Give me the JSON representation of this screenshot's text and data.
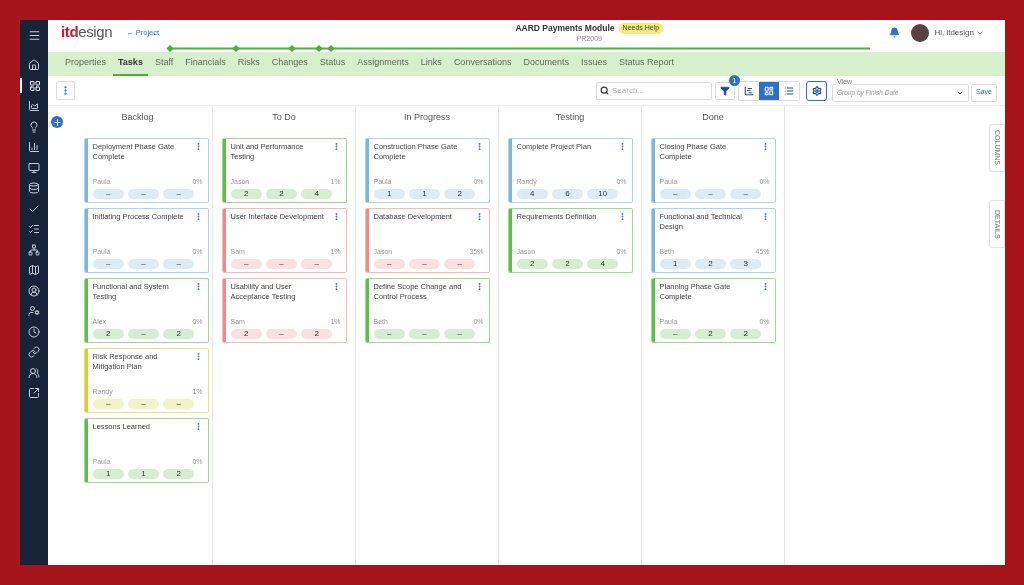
{
  "sidebar": {
    "items": [
      {
        "selected": false
      },
      {
        "selected": true
      },
      {
        "selected": false
      },
      {
        "selected": false
      },
      {
        "selected": false
      },
      {
        "selected": false
      },
      {
        "selected": false
      },
      {
        "selected": false
      },
      {
        "selected": false
      },
      {
        "selected": false
      },
      {
        "selected": false
      },
      {
        "selected": false
      },
      {
        "selected": false
      },
      {
        "selected": false
      },
      {
        "selected": false
      },
      {
        "selected": false
      },
      {
        "selected": false
      }
    ]
  },
  "header": {
    "logo_accent": "itd",
    "logo_rest": "esign",
    "back_link": "← Project",
    "title": "AARD Payments Module",
    "badge": "Needs Help",
    "code": "PR2009",
    "user": "Hi, itdesign"
  },
  "tabs": [
    {
      "label": "Properties",
      "selected": false
    },
    {
      "label": "Tasks",
      "selected": true
    },
    {
      "label": "Staff",
      "selected": false
    },
    {
      "label": "Financials",
      "selected": false
    },
    {
      "label": "Risks",
      "selected": false
    },
    {
      "label": "Changes",
      "selected": false
    },
    {
      "label": "Status",
      "selected": false
    },
    {
      "label": "Assignments",
      "selected": false
    },
    {
      "label": "Links",
      "selected": false
    },
    {
      "label": "Conversations",
      "selected": false
    },
    {
      "label": "Documents",
      "selected": false
    },
    {
      "label": "Issues",
      "selected": false
    },
    {
      "label": "Status Report",
      "selected": false
    }
  ],
  "toolbar": {
    "search": {
      "placeholder": "Search..."
    },
    "filter_count": "1",
    "view_modes": [
      {
        "kind": "gantt",
        "selected": false
      },
      {
        "kind": "board",
        "selected": true
      },
      {
        "kind": "list",
        "selected": false
      }
    ],
    "view": {
      "label": "View",
      "value": "Group by Finish Date"
    },
    "save": "Save"
  },
  "side_tabs": [
    "COLUMNS",
    "DETAILS"
  ],
  "columns": [
    {
      "title": "Backlog",
      "cards": [
        {
          "title": "Deployment Phase Gate Complete",
          "assignee": "Paula",
          "percent": "0%",
          "color": "#7ab6dd",
          "pills": [
            "–",
            "–",
            "–"
          ]
        },
        {
          "title": "Initiating Process Complete",
          "assignee": "Paula",
          "percent": "0%",
          "color": "#7ab6dd",
          "pills": [
            "–",
            "–",
            "–"
          ]
        },
        {
          "title": "Functional and System Testing",
          "assignee": "Alex",
          "percent": "0%",
          "color": "#5cbf4a",
          "pills": [
            "2",
            "–",
            "2"
          ]
        },
        {
          "title": "Risk Response and Mitigation Plan",
          "assignee": "Randy",
          "percent": "1%",
          "color": "#d6cf2e",
          "pills": [
            "–",
            "–",
            "–"
          ]
        },
        {
          "title": "Lessons Learned",
          "assignee": "Paula",
          "percent": "0%",
          "color": "#5cbf4a",
          "pills": [
            "1",
            "1",
            "2"
          ]
        }
      ]
    },
    {
      "title": "To Do",
      "cards": [
        {
          "title": "Unit and Performance Testing",
          "assignee": "Jason",
          "percent": "1%",
          "color": "#5cbf4a",
          "pills": [
            "2",
            "2",
            "4"
          ]
        },
        {
          "title": "User Interface Development",
          "assignee": "Sam",
          "percent": "1%",
          "color": "#ee8a8a",
          "pills": [
            "–",
            "–",
            "–"
          ]
        },
        {
          "title": "Usability and User Acceptance Testing",
          "assignee": "Sam",
          "percent": "1%",
          "color": "#ee8a8a",
          "pills": [
            "2",
            "–",
            "2"
          ]
        }
      ]
    },
    {
      "title": "In Progress",
      "cards": [
        {
          "title": "Construction Phase Gate Complete",
          "assignee": "Paula",
          "percent": "0%",
          "color": "#7ab6dd",
          "pills": [
            "1",
            "1",
            "2"
          ]
        },
        {
          "title": "Database Development",
          "assignee": "Jason",
          "percent": "35%",
          "color": "#ee8a8a",
          "pills": [
            "–",
            "–",
            "–"
          ]
        },
        {
          "title": "Define Scope Change and Control Process",
          "assignee": "Beth",
          "percent": "0%",
          "color": "#5cbf4a",
          "pills": [
            "–",
            "–",
            "–"
          ]
        }
      ]
    },
    {
      "title": "Testing",
      "cards": [
        {
          "title": "Complete Project Plan",
          "assignee": "Randy",
          "percent": "0%",
          "color": "#7ab6dd",
          "pills": [
            "4",
            "6",
            "10"
          ]
        },
        {
          "title": "Requirements Definition",
          "assignee": "Jason",
          "percent": "0%",
          "color": "#5cbf4a",
          "pills": [
            "2",
            "2",
            "4"
          ]
        }
      ]
    },
    {
      "title": "Done",
      "cards": [
        {
          "title": "Closing Phase Gate Complete",
          "assignee": "Paula",
          "percent": "0%",
          "color": "#7ab6dd",
          "pills": [
            "–",
            "–",
            "–"
          ]
        },
        {
          "title": "Functional and Technical Design",
          "assignee": "Beth",
          "percent": "45%",
          "color": "#7ab6dd",
          "pills": [
            "1",
            "2",
            "3"
          ]
        },
        {
          "title": "Planning Phase Gate Complete",
          "assignee": "Paula",
          "percent": "0%",
          "color": "#5cbf4a",
          "pills": [
            "–",
            "2",
            "2"
          ]
        }
      ]
    }
  ]
}
